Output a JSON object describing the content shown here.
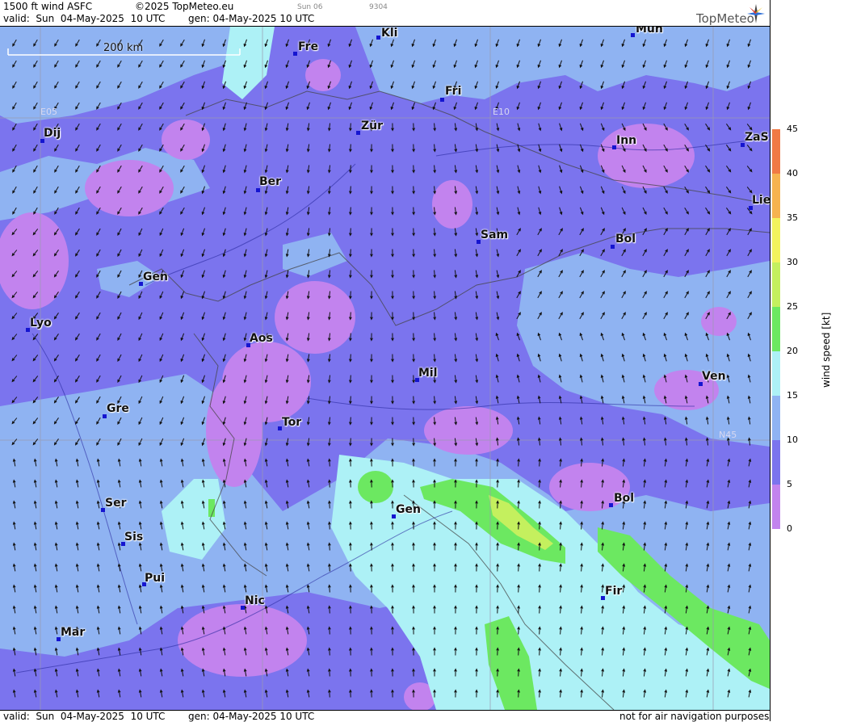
{
  "header": {
    "product": "1500 ft wind ASFC",
    "copyright": "©2025 TopMeteo.eu",
    "day": "Sun 06",
    "code": "9304",
    "valid": "valid:  Sun  04-May-2025  10 UTC",
    "generated": "gen: 04-May-2025 10 UTC",
    "logo": "TopMeteo"
  },
  "footer": {
    "valid": "valid:  Sun  04-May-2025  10 UTC",
    "generated": "gen: 04-May-2025 10 UTC",
    "disclaimer": "not for air navigation purposes"
  },
  "scale_bar": {
    "label": "200 km"
  },
  "grid_labels": {
    "e05": "E05",
    "e10": "E10",
    "n45": "N45"
  },
  "colorbar": {
    "label": "wind speed [kt]",
    "ticks": [
      "0",
      "5",
      "10",
      "15",
      "20",
      "25",
      "30",
      "35",
      "40",
      "45"
    ],
    "colors": [
      "#c283ee",
      "#7b74ee",
      "#8fb3f2",
      "#adf1f6",
      "#6ce861",
      "#c4f05e",
      "#f2f35d",
      "#f6b34f",
      "#f07a44",
      "#e8564b"
    ]
  },
  "cities": [
    {
      "name": "Kli"
    },
    {
      "name": "Mün"
    },
    {
      "name": "Fre"
    },
    {
      "name": "Fri"
    },
    {
      "name": "Zür"
    },
    {
      "name": "Dij"
    },
    {
      "name": "Inn"
    },
    {
      "name": "ZaS"
    },
    {
      "name": "Ber"
    },
    {
      "name": "Lie"
    },
    {
      "name": "Sam"
    },
    {
      "name": "Bol"
    },
    {
      "name": "Gen"
    },
    {
      "name": "Lyo"
    },
    {
      "name": "Aos"
    },
    {
      "name": "Mil"
    },
    {
      "name": "Ven"
    },
    {
      "name": "Gre"
    },
    {
      "name": "Tor"
    },
    {
      "name": "Ser"
    },
    {
      "name": "Gen"
    },
    {
      "name": "Bol"
    },
    {
      "name": "Sis"
    },
    {
      "name": "Pui"
    },
    {
      "name": "Fir"
    },
    {
      "name": "Nic"
    },
    {
      "name": "Mar"
    }
  ]
}
